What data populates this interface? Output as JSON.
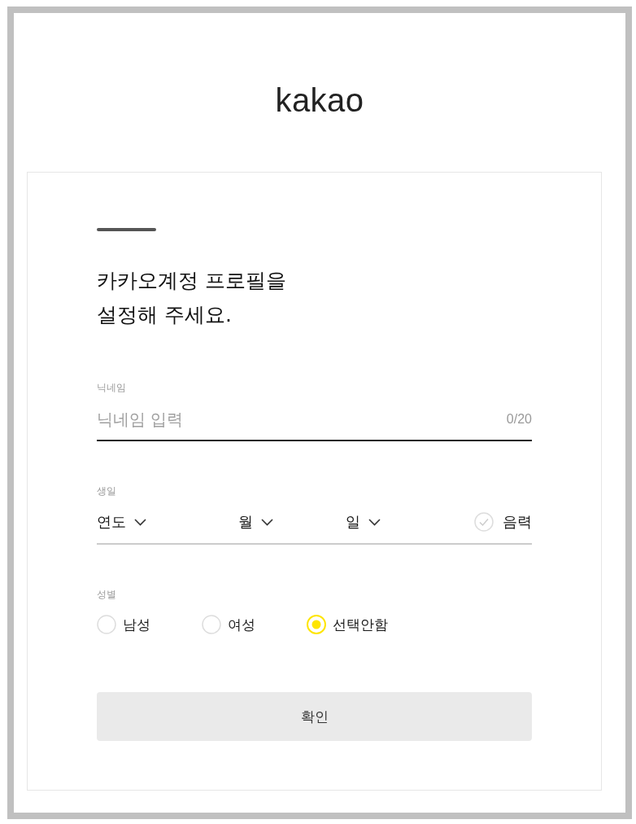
{
  "logo": {
    "text": "kakao"
  },
  "heading": {
    "text": "카카오계정 프로필을\n설정해 주세요."
  },
  "nickname": {
    "label": "닉네임",
    "placeholder": "닉네임 입력",
    "counter": "0/20",
    "focused": true
  },
  "birthday": {
    "label": "생일",
    "selects": [
      {
        "label": "연도"
      },
      {
        "label": "월"
      },
      {
        "label": "일"
      }
    ],
    "lunar": {
      "label": "음력",
      "checked": false
    }
  },
  "gender": {
    "label": "성별",
    "options": [
      {
        "label": "남성",
        "selected": false
      },
      {
        "label": "여성",
        "selected": false
      },
      {
        "label": "선택안함",
        "selected": true
      }
    ]
  },
  "confirm_button": {
    "label": "확인",
    "disabled": true
  }
}
